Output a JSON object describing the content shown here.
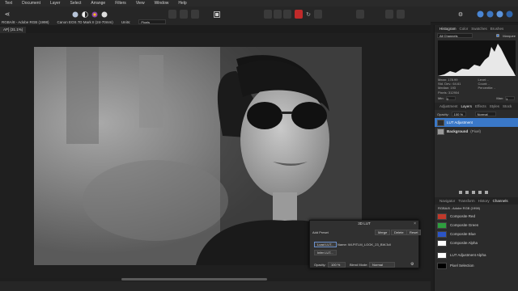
{
  "menubar": {
    "items": [
      "Text",
      "Document",
      "Layer",
      "Select",
      "Arrange",
      "Filters",
      "View",
      "Window",
      "Help"
    ]
  },
  "context_bar": {
    "doc_info": "RGBA/8 - Adobe RGB (1998)",
    "camera": "Canon EOS 7D Mark II (24-70mm)",
    "units_label": "Units:",
    "units_value": "Pixels"
  },
  "document_tab": {
    "label": "AP] (31.1%)"
  },
  "histogram_panel": {
    "tabs": [
      "Histogram",
      "Color",
      "Swatches",
      "Brushes"
    ],
    "channel_select": "All Channels",
    "checkbox_label": "Marquee",
    "stats_left": [
      "Mean: 178.99",
      "Std. Dev.: 64.61",
      "Median: 193",
      "Pixels: 312904"
    ],
    "stats_right": [
      "Level: -",
      "Count: -",
      "Percentile: -"
    ],
    "min_label": "Min:",
    "min_value": "0",
    "max_label": "Max:",
    "max_value": "1"
  },
  "layers_panel": {
    "tabs": [
      "Adjustment",
      "Layers",
      "Effects",
      "Styles",
      "Stock"
    ],
    "opacity_label": "Opacity:",
    "opacity_value": "100 %",
    "blend_value": "Normal",
    "layers": [
      {
        "name": "LUT Adjustment",
        "selected": true
      },
      {
        "name": "Background",
        "suffix": "(Pixel)",
        "selected": false
      }
    ]
  },
  "channels_panel": {
    "tabs": [
      "Navigator",
      "Transform",
      "History",
      "Channels"
    ],
    "header": "RGBA/8 - Adobe RGB (1998)",
    "channels": [
      {
        "name": "Composite Red",
        "color": "#c0392b"
      },
      {
        "name": "Composite Green",
        "color": "#2e9e3e"
      },
      {
        "name": "Composite Blue",
        "color": "#2b55c7"
      },
      {
        "name": "Composite Alpha",
        "color": "#ffffff"
      },
      {
        "name": "LUT Adjustment Alpha",
        "color": "#ffffff"
      },
      {
        "name": "Pixel Selection",
        "color": "#000000"
      }
    ]
  },
  "lut_dialog": {
    "title": "3D LUT",
    "add_preset": "Add Preset",
    "merge": "Merge",
    "delete": "Delete",
    "reset": "Reset",
    "load_lut": "Load LUT...",
    "infer_lut": "Infer LUT...",
    "lut_name": "Name: WLPITLM_LOOK_23_BW.3dl",
    "opacity_label": "Opacity:",
    "opacity_value": "100 %",
    "blend_label": "Blend Mode:",
    "blend_value": "Normal"
  },
  "colors": {
    "accent": "#3a78c8",
    "selected_button": "#c02a2a"
  }
}
